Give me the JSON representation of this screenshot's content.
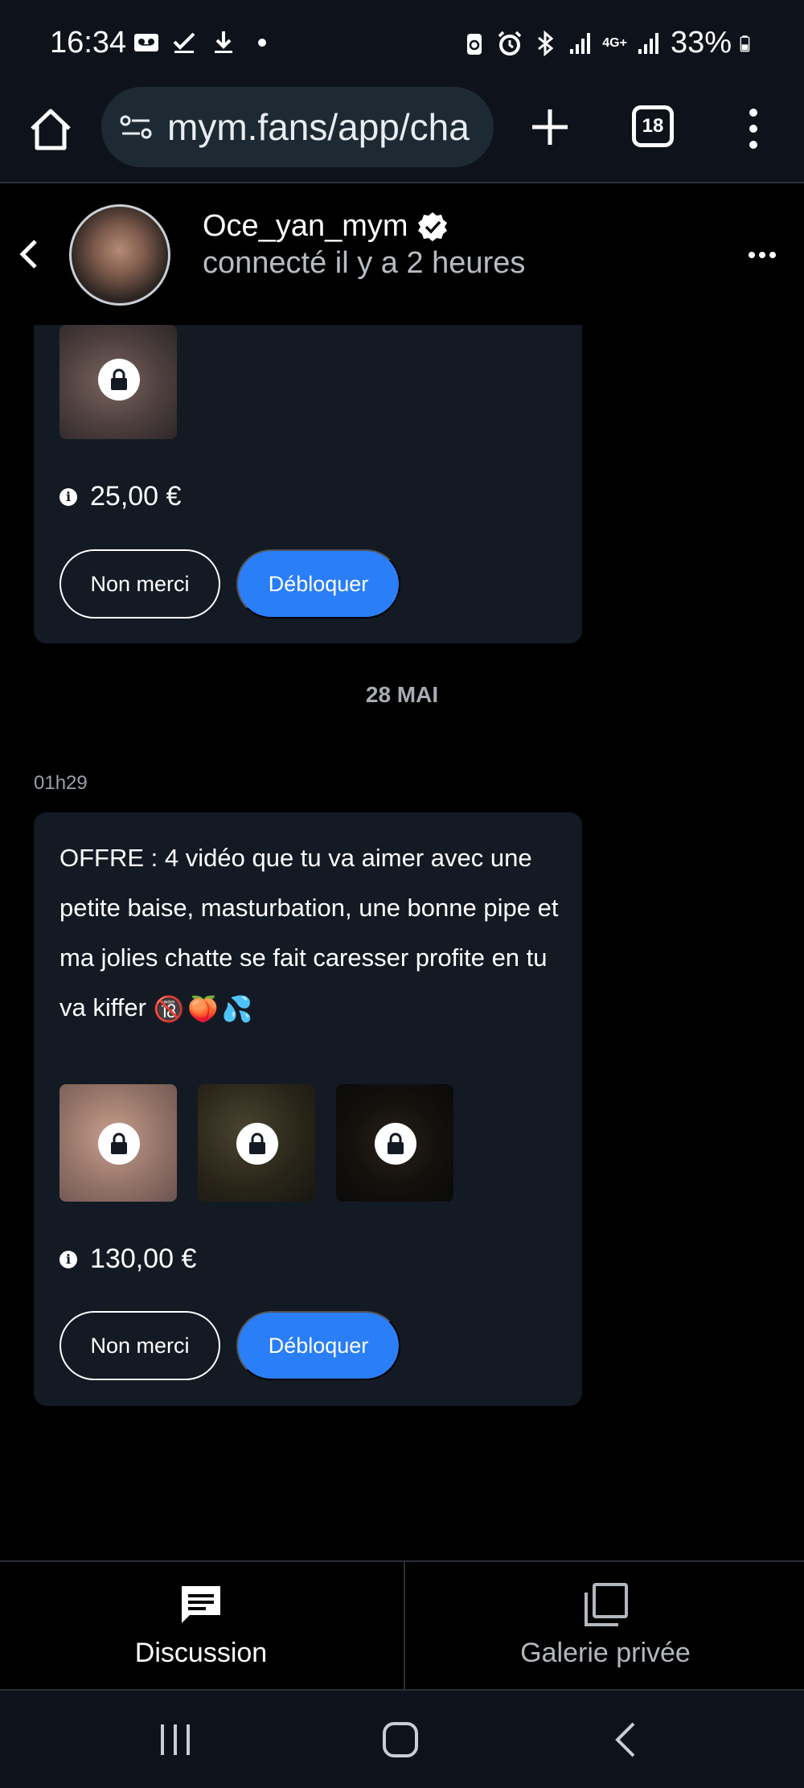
{
  "status_bar": {
    "time": "16:34",
    "battery": "33%",
    "network": "4G+"
  },
  "browser": {
    "url": "mym.fans/app/cha",
    "tab_count": "18"
  },
  "chat_header": {
    "username": "Oce_yan_mym",
    "presence": "connecté il y a 2 heures"
  },
  "messages": {
    "first_offer": {
      "price": "25,00 €",
      "decline_label": "Non merci",
      "unlock_label": "Débloquer"
    },
    "date_separator": "28 MAI",
    "second_offer": {
      "time": "01h29",
      "text": "OFFRE : 4 vidéo que tu va aimer avec une petite baise, masturbation, une bonne pipe et ma jolies chatte se fait caresser profite en tu va kiffer",
      "emojis": [
        "🔞",
        "🍑",
        "💦"
      ],
      "price": "130,00 €",
      "decline_label": "Non merci",
      "unlock_label": "Débloquer"
    }
  },
  "bottom_nav": {
    "discussion_label": "Discussion",
    "gallery_label": "Galerie privée"
  },
  "colors": {
    "accent": "#2a7ef8",
    "bubble": "#141a24",
    "background": "#000000"
  }
}
